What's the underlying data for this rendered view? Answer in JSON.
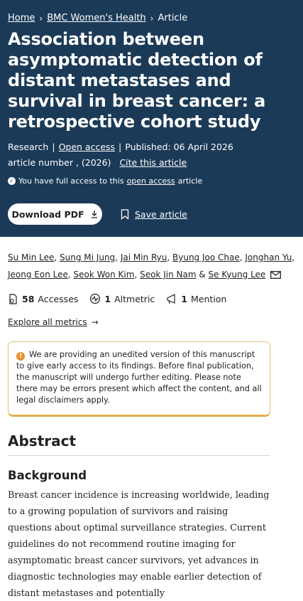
{
  "breadcrumb": {
    "home": "Home",
    "journal": "BMC Women's Health",
    "current": "Article"
  },
  "article": {
    "title": "Association between asymptomatic detection of distant metastases and survival in breast cancer: a retrospective cohort study",
    "type": "Research",
    "open_access": "Open access",
    "published": "Published: 06 April 2026",
    "article_number": "article number , (2026)",
    "cite": "Cite this article"
  },
  "access": {
    "prefix": "You have full access to this",
    "link": "open access",
    "suffix": "article"
  },
  "actions": {
    "download_pdf": "Download PDF",
    "save": "Save article"
  },
  "authors": [
    "Su Min Lee",
    "Sung Mi Jung",
    "Jai Min Ryu",
    "Byung Joo Chae",
    "Jonghan Yu",
    "Jeong Eon Lee",
    "Seok Won Kim",
    "Seok Jin Nam",
    "Se Kyung Lee"
  ],
  "metrics": {
    "accesses_count": "58",
    "accesses_label": "Accesses",
    "altmetric_count": "1",
    "altmetric_label": "Altmetric",
    "mention_count": "1",
    "mention_label": "Mention",
    "explore": "Explore all metrics"
  },
  "notice": "We are providing an unedited version of this manuscript to give early access to its findings. Before final publication, the manuscript will undergo further editing. Please note there may be errors present which affect the content, and all legal disclaimers apply.",
  "abstract": {
    "heading": "Abstract",
    "background_heading": "Background",
    "background_text": "Breast cancer incidence is increasing worldwide, leading to a growing population of survivors and raising questions about optimal surveillance strategies. Current guidelines do not recommend routine imaging for asymptomatic breast cancer survivors, yet advances in diagnostic technologies may enable earlier detection of distant metastases and potentially"
  },
  "colors": {
    "hero_bg": "#1b3a57",
    "notice_border": "#e0b04d",
    "warning": "#e8922f"
  }
}
